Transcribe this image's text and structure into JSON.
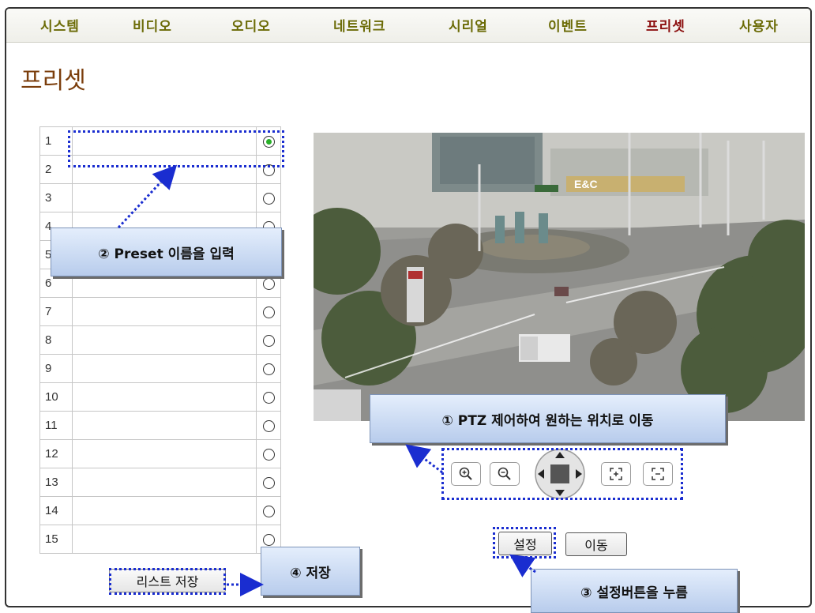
{
  "nav": {
    "items": [
      "시스템",
      "비디오",
      "오디오",
      "네트워크",
      "시리얼",
      "이벤트",
      "프리셋",
      "사용자"
    ],
    "active": "프리셋"
  },
  "page_title": "프리셋",
  "presets": [
    {
      "num": "1",
      "name": "",
      "selected": true
    },
    {
      "num": "2",
      "name": "",
      "selected": false
    },
    {
      "num": "3",
      "name": "",
      "selected": false
    },
    {
      "num": "4",
      "name": "",
      "selected": false
    },
    {
      "num": "5",
      "name": "",
      "selected": false
    },
    {
      "num": "6",
      "name": "",
      "selected": false
    },
    {
      "num": "7",
      "name": "",
      "selected": false
    },
    {
      "num": "8",
      "name": "",
      "selected": false
    },
    {
      "num": "9",
      "name": "",
      "selected": false
    },
    {
      "num": "10",
      "name": "",
      "selected": false
    },
    {
      "num": "11",
      "name": "",
      "selected": false
    },
    {
      "num": "12",
      "name": "",
      "selected": false
    },
    {
      "num": "13",
      "name": "",
      "selected": false
    },
    {
      "num": "14",
      "name": "",
      "selected": false
    },
    {
      "num": "15",
      "name": "",
      "selected": false
    }
  ],
  "camera": {
    "sign_text": "E&C"
  },
  "ptz_icons": [
    "zoom-in-icon",
    "zoom-out-icon",
    "direction-pad-icon",
    "focus-near-icon",
    "focus-far-icon"
  ],
  "buttons": {
    "set_label": "설정",
    "move_label": "이동",
    "save_list_label": "리스트 저장"
  },
  "callouts": {
    "step1": "① PTZ 제어하여 원하는 위치로 이동",
    "step2": "② Preset 이름을 입력",
    "step3": "③ 설정버튼을 누름",
    "step4": "④ 저장"
  },
  "colors": {
    "nav_text": "#6b6b06",
    "nav_active": "#8c1010",
    "title": "#7b3e0c",
    "annotation_blue": "#1a2dd0",
    "radio_checked": "#28b028"
  }
}
